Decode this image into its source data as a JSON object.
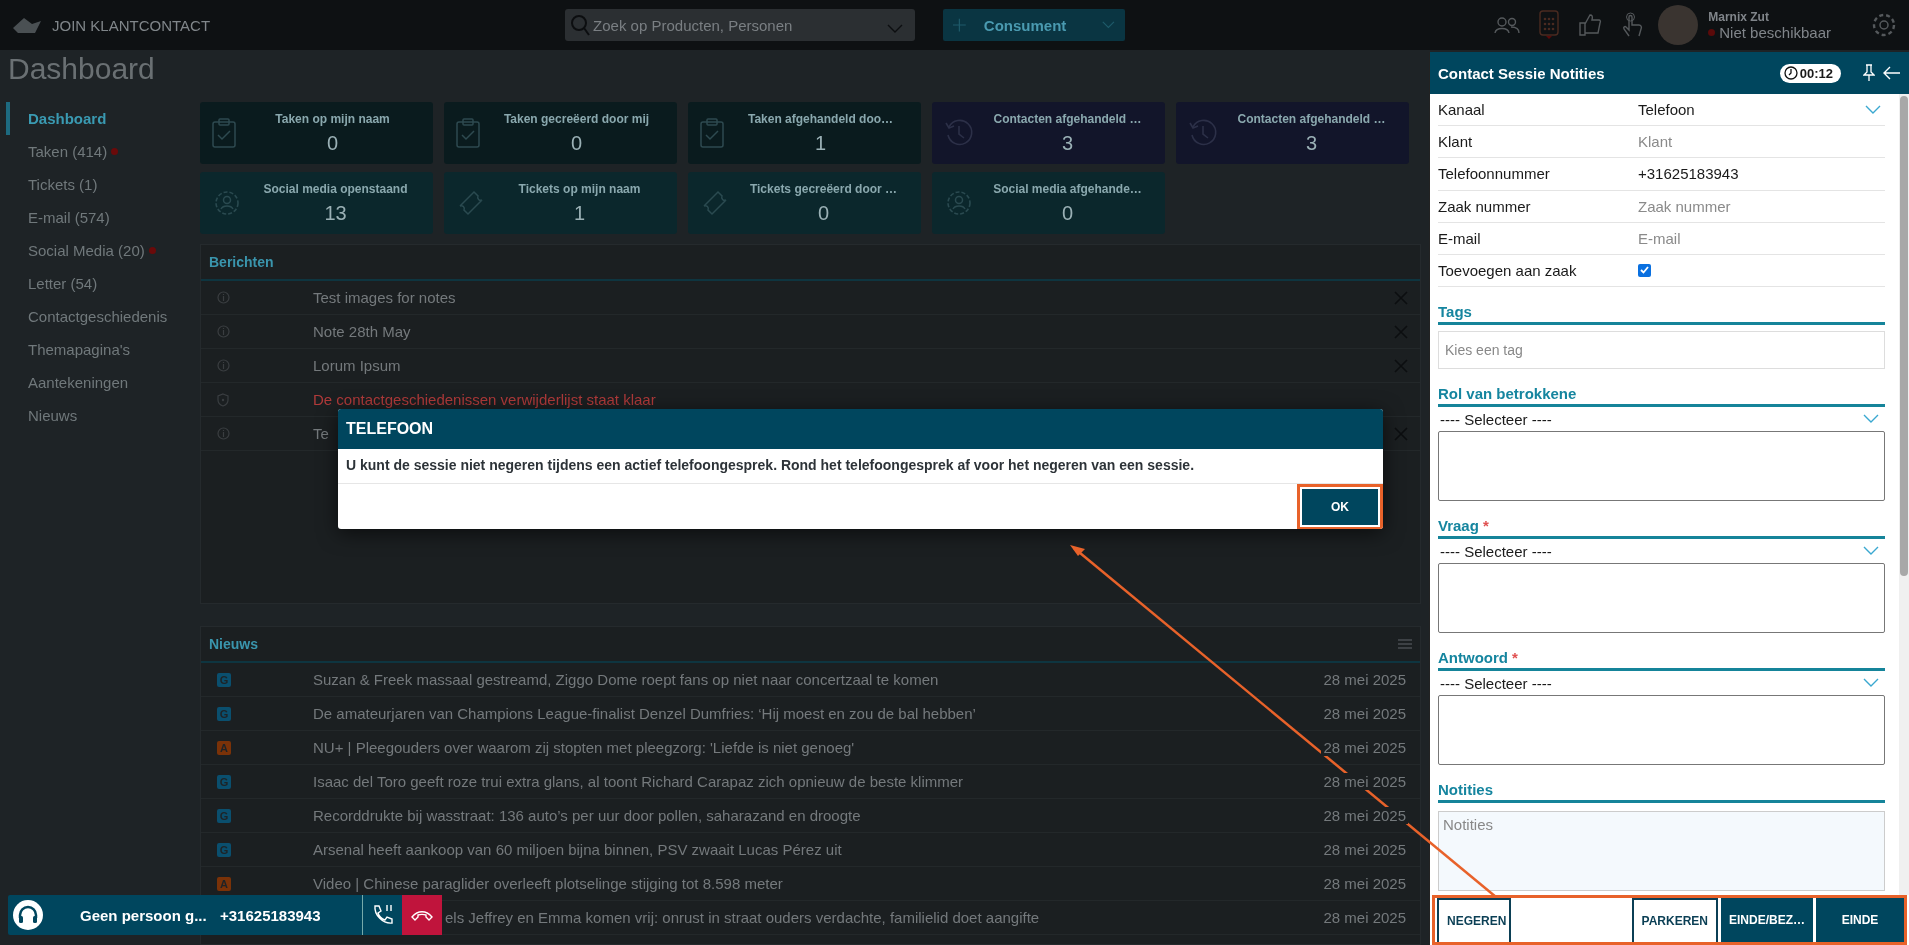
{
  "topbar": {
    "brand": "JOIN KLANTCONTACT",
    "search": {
      "placeholder": "Zoek op Producten, Personen"
    },
    "new_button": "Consument",
    "user": {
      "name": "Marnix Zut",
      "status": "Niet beschikbaar"
    }
  },
  "page_title": "Dashboard",
  "sidebar": {
    "items": [
      {
        "label": "Dashboard",
        "selected": true,
        "alert": false
      },
      {
        "label": "Taken (414)",
        "selected": false,
        "alert": true
      },
      {
        "label": "Tickets (1)",
        "selected": false,
        "alert": false
      },
      {
        "label": "E-mail (574)",
        "selected": false,
        "alert": false
      },
      {
        "label": "Social Media (20)",
        "selected": false,
        "alert": true
      },
      {
        "label": "Letter (54)",
        "selected": false,
        "alert": false
      },
      {
        "label": "Contactgeschiedenis",
        "selected": false,
        "alert": false
      },
      {
        "label": "Themapagina's",
        "selected": false,
        "alert": false
      },
      {
        "label": "Aantekeningen",
        "selected": false,
        "alert": false
      },
      {
        "label": "Nieuws",
        "selected": false,
        "alert": false
      }
    ]
  },
  "tiles": [
    {
      "title": "Taken op mijn naam",
      "count": "0",
      "kind": "task"
    },
    {
      "title": "Taken gecreëerd door mij",
      "count": "0",
      "kind": "task"
    },
    {
      "title": "Taken afgehandeld doo…",
      "count": "1",
      "kind": "task"
    },
    {
      "title": "Contacten afgehandeld …",
      "count": "3",
      "kind": "contact"
    },
    {
      "title": "Contacten afgehandeld …",
      "count": "3",
      "kind": "contact"
    },
    {
      "title": "Social media openstaand",
      "count": "13",
      "kind": "social"
    },
    {
      "title": "Tickets op mijn naam",
      "count": "1",
      "kind": "ticket"
    },
    {
      "title": "Tickets gecreëerd door …",
      "count": "0",
      "kind": "ticket"
    },
    {
      "title": "Social media afgehande…",
      "count": "0",
      "kind": "social"
    }
  ],
  "messages": {
    "title": "Berichten",
    "rows": [
      {
        "text": "Test images for notes",
        "kind": "info",
        "alert": false,
        "closable": true
      },
      {
        "text": "Note 28th May",
        "kind": "info",
        "alert": false,
        "closable": true
      },
      {
        "text": "Lorum Ipsum",
        "kind": "info",
        "alert": false,
        "closable": true
      },
      {
        "text": "De contactgeschiedenissen verwijderlijst staat klaar",
        "kind": "shield",
        "alert": true,
        "closable": false
      },
      {
        "text": "Te",
        "kind": "info",
        "alert": false,
        "closable": true
      }
    ]
  },
  "news": {
    "title": "Nieuws",
    "rows": [
      {
        "kind": "full",
        "source": "G",
        "color": "#0a4f6e",
        "text": "Suzan & Freek massaal gestreamd, Ziggo Dome roept fans op niet naar concertzaal te komen",
        "date": "28 mei 2025"
      },
      {
        "kind": "full",
        "source": "G",
        "color": "#0a4f6e",
        "text": "De amateurjaren van Champions League-finalist Denzel Dumfries: ‘Hij moest en zou de bal hebben’",
        "date": "28 mei 2025"
      },
      {
        "kind": "full",
        "source": "A",
        "color": "#7a3208",
        "text": "NU+ | Pleegouders over waarom zij stopten met pleegzorg: 'Liefde is niet genoeg'",
        "date": "28 mei 2025"
      },
      {
        "kind": "full",
        "source": "G",
        "color": "#0a4f6e",
        "text": "Isaac del Toro geeft roze trui extra glans, al toont Richard Carapaz zich opnieuw de beste klimmer",
        "date": "28 mei 2025"
      },
      {
        "kind": "full",
        "source": "G",
        "color": "#0a4f6e",
        "text": "Recorddrukte bij wasstraat: 136 auto’s per uur door pollen, saharazand en droogte",
        "date": "28 mei 2025"
      },
      {
        "kind": "full",
        "source": "G",
        "color": "#0a4f6e",
        "text": "Arsenal heeft aankoop van 60 miljoen bijna binnen, PSV zwaait Lucas Pérez uit",
        "date": "28 mei 2025"
      },
      {
        "kind": "full",
        "source": "A",
        "color": "#7a3208",
        "text": "Video | Chinese paraglider overleeft plotselinge stijging tot 8.598 meter",
        "date": "28 mei 2025"
      },
      {
        "kind": "covered",
        "text": "els Jeffrey en Emma komen vrij: onrust in straat ouders verdachte, familielid doet aangifte",
        "date": "28 mei 2025"
      }
    ]
  },
  "dialog": {
    "title": "TELEFOON",
    "message": "U kunt de sessie niet negeren tijdens een actief telefoongesprek. Rond het telefoongesprek af voor het negeren van een sessie.",
    "button": "OK"
  },
  "session_panel": {
    "title": "Contact Sessie Notities",
    "timer": "00:12",
    "fields": [
      {
        "label": "Kanaal",
        "kind": "select",
        "value": "Telefoon"
      },
      {
        "label": "Klant",
        "kind": "input",
        "placeholder": "Klant"
      },
      {
        "label": "Telefoonnummer",
        "kind": "input",
        "value": "+31625183943"
      },
      {
        "label": "Zaak nummer",
        "kind": "input",
        "placeholder": "Zaak nummer"
      },
      {
        "label": "E-mail",
        "kind": "input",
        "placeholder": "E-mail"
      },
      {
        "label": "Toevoegen aan zaak",
        "kind": "checkbox",
        "checked": true
      }
    ],
    "sections": [
      {
        "title": "Tags",
        "kind": "tags",
        "placeholder": "Kies een tag"
      },
      {
        "title": "Rol van betrokkene",
        "kind": "select",
        "value": "---- Selecteer ----"
      },
      {
        "title": "Vraag",
        "kind": "select",
        "marker": "*",
        "value": "---- Selecteer ----"
      },
      {
        "title": "Antwoord",
        "kind": "select",
        "marker": "*",
        "value": "---- Selecteer ----"
      },
      {
        "title": "Notities",
        "kind": "notes",
        "placeholder": "Notities"
      }
    ],
    "actions": [
      {
        "label": "NEGEREN",
        "kind": "outline"
      },
      {
        "label": "PARKEREN",
        "kind": "outline"
      },
      {
        "label": "EINDE/BEZ…",
        "kind": "filled"
      },
      {
        "label": "EINDE",
        "kind": "filled"
      }
    ]
  },
  "call_bar": {
    "caller": "Geen persoon g...",
    "number": "+31625183943"
  }
}
